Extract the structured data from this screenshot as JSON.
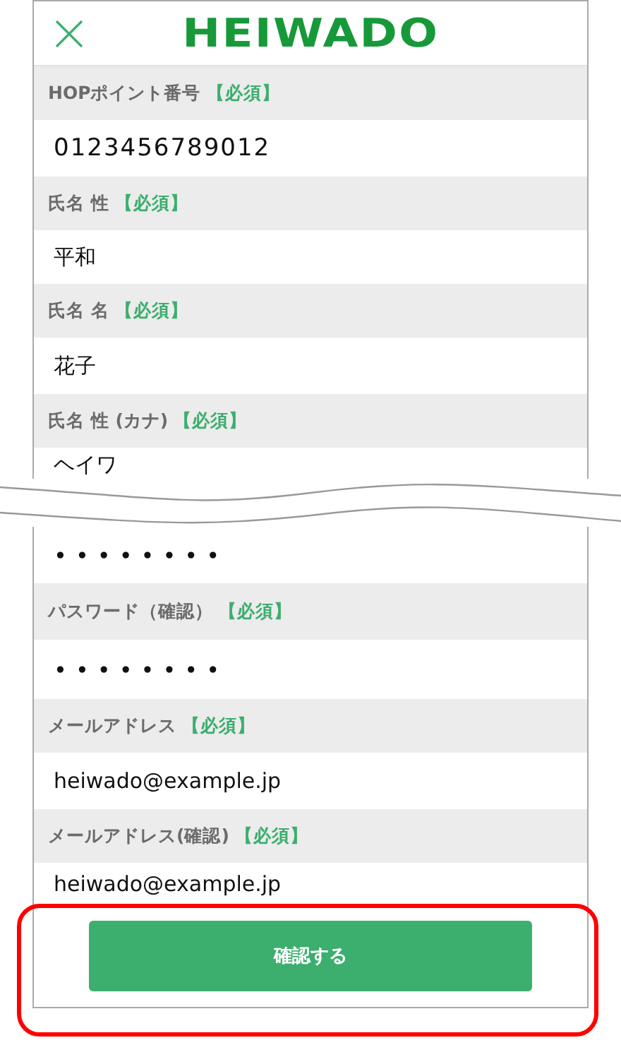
{
  "header": {
    "logo": "HEIWADO"
  },
  "sections": [
    {
      "fields": [
        {
          "label": "HOPポイント番号",
          "required": "【必須】",
          "value": "0123456789012",
          "kind": "number"
        },
        {
          "label": "氏名 性",
          "required": "【必須】",
          "value": "平和",
          "kind": "text"
        },
        {
          "label": "氏名 名",
          "required": "【必須】",
          "value": "花子",
          "kind": "text"
        },
        {
          "label": "氏名 性 (カナ)",
          "required": "【必須】",
          "value": "ヘイワ",
          "kind": "text"
        }
      ]
    },
    {
      "fields": [
        {
          "value": "••••••••",
          "kind": "password"
        },
        {
          "label": "パスワード（確認）",
          "required": "【必須】",
          "value": "••••••••",
          "kind": "password"
        },
        {
          "label": "メールアドレス",
          "required": "【必須】",
          "value": "heiwado@example.jp",
          "kind": "text"
        },
        {
          "label": "メールアドレス(確認)",
          "required": "【必須】",
          "value": "heiwado@example.jp",
          "kind": "text"
        }
      ]
    }
  ],
  "submit": {
    "label": "確認する",
    "highlighted": true
  }
}
